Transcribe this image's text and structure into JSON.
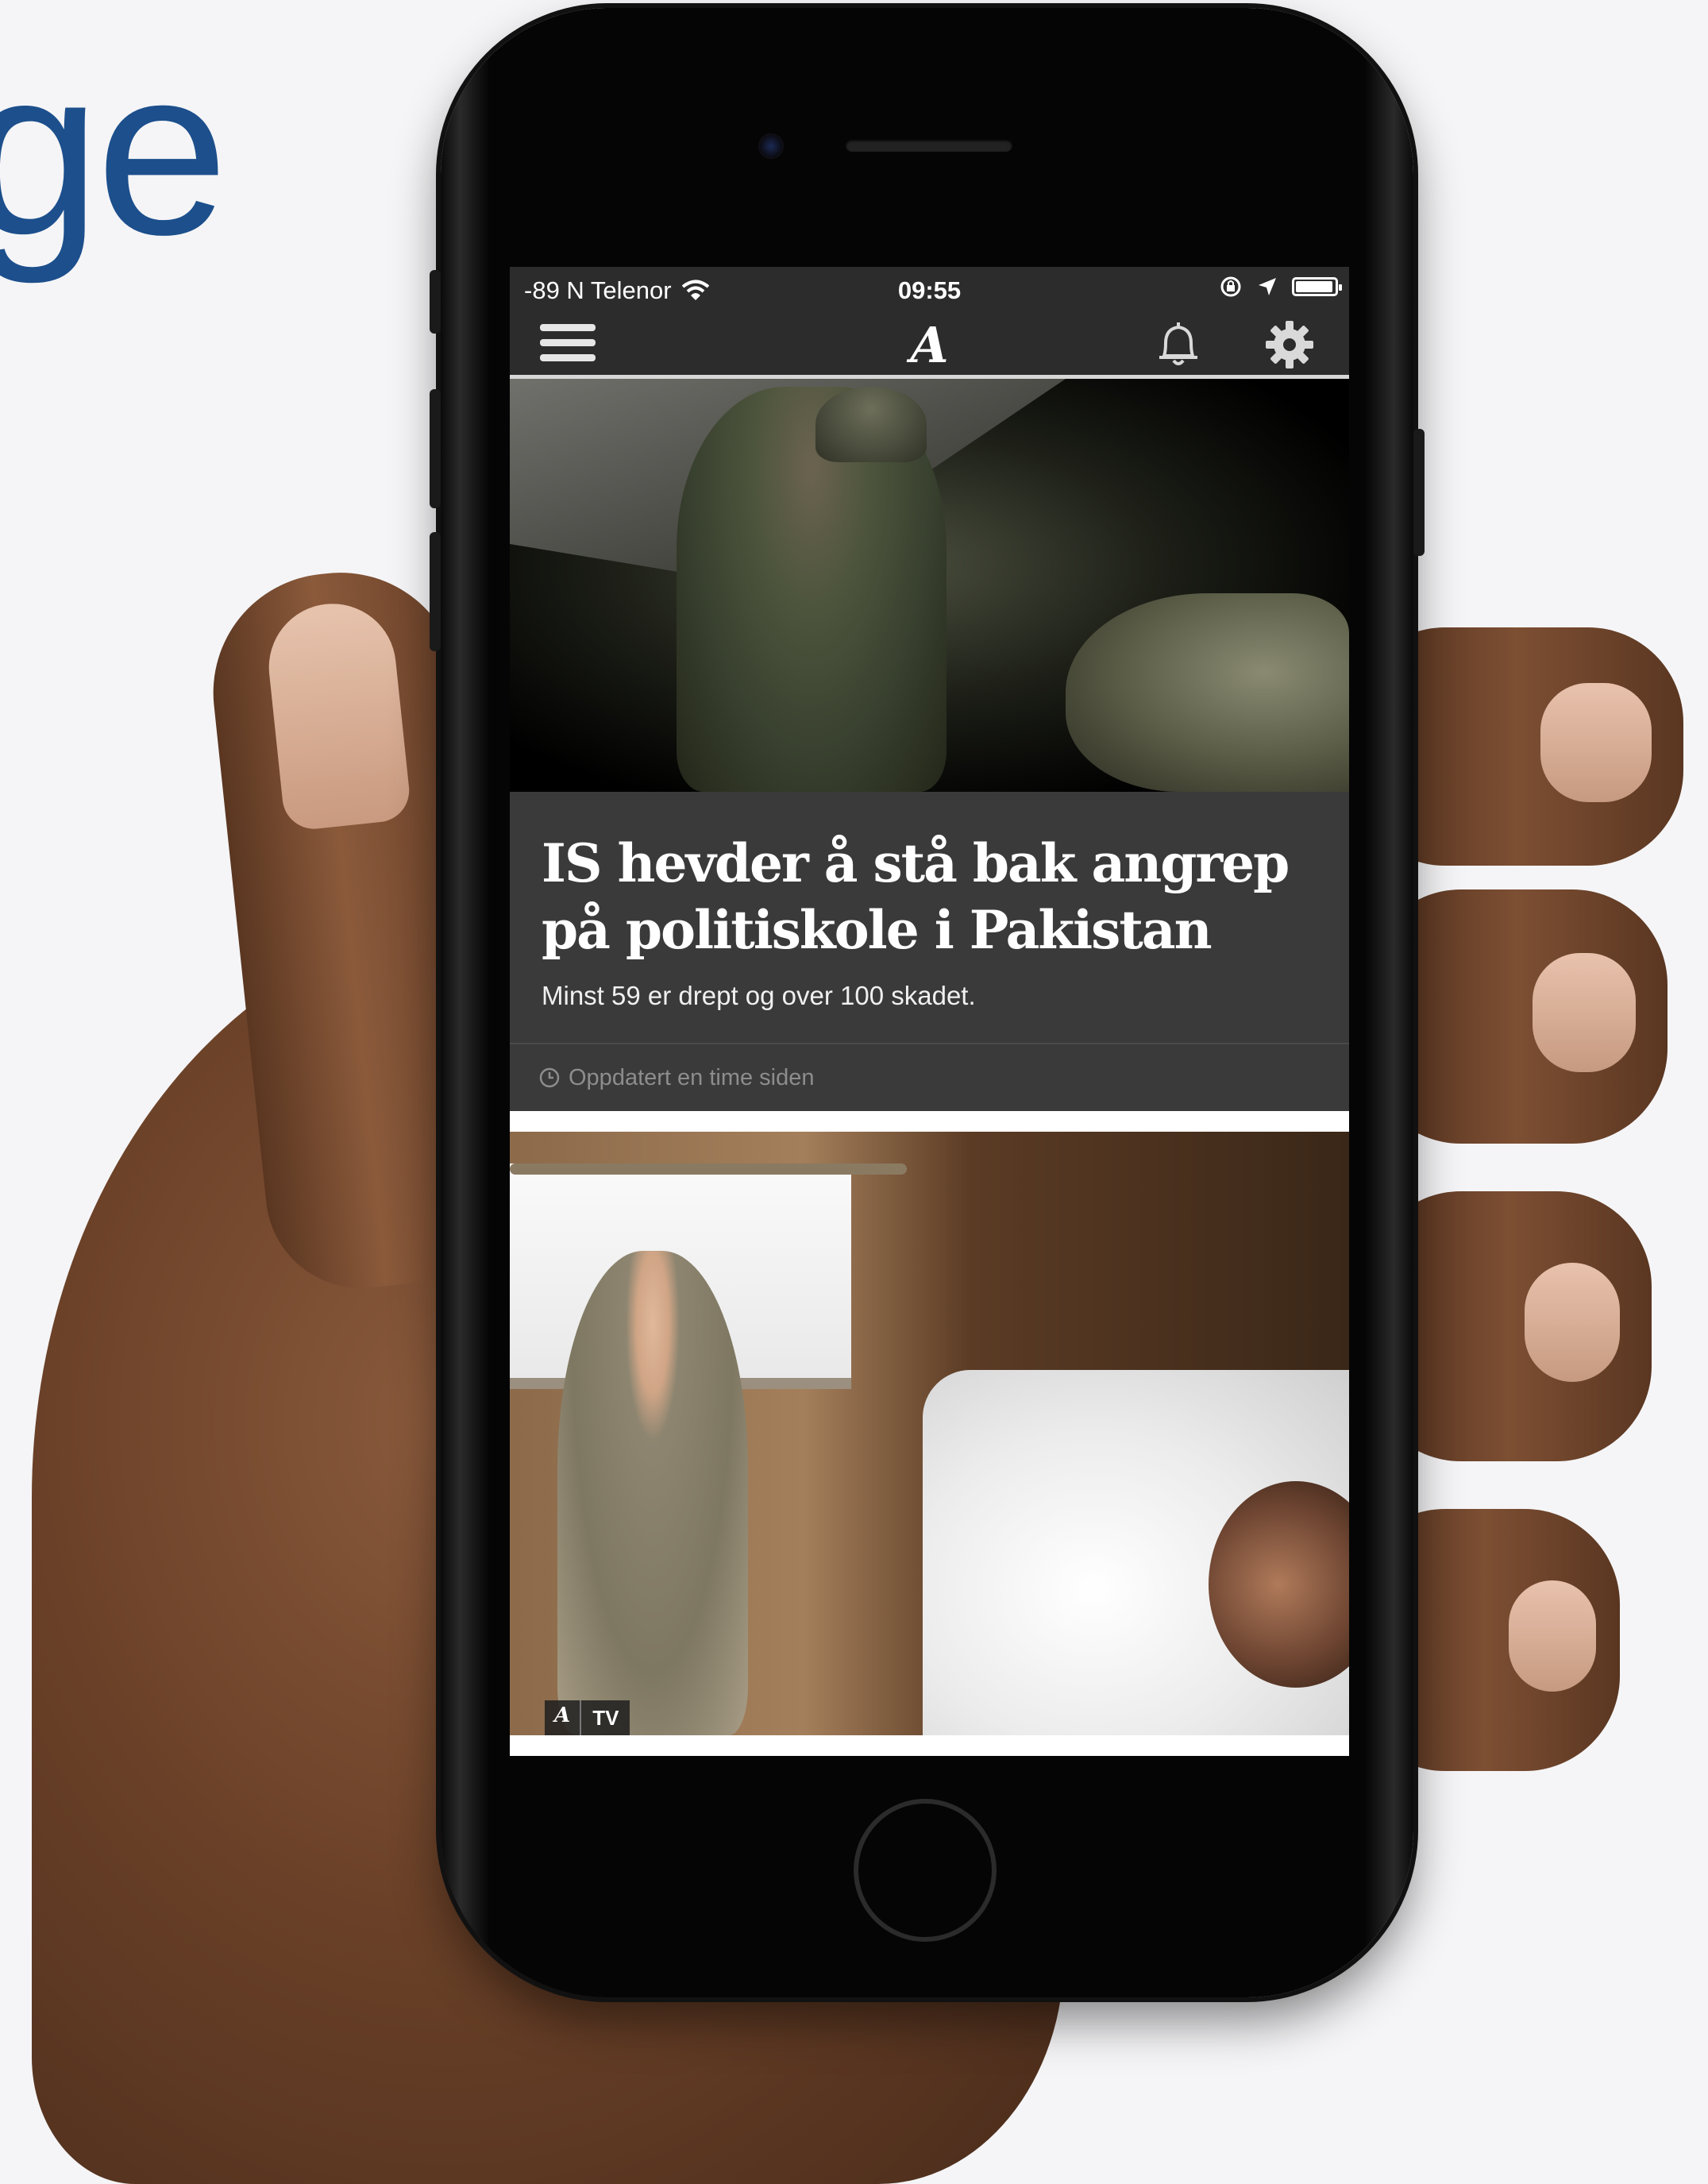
{
  "background_text": "ge",
  "status_bar": {
    "carrier": "-89 N Telenor",
    "time": "09:55",
    "battery_level": 0.95
  },
  "nav": {
    "logo": "A",
    "icons": [
      "menu-icon",
      "bell-icon",
      "gear-icon"
    ]
  },
  "articles": [
    {
      "headline": "IS hevder å stå bak angrep på politiskole i Pakistan",
      "lead": "Minst 59 er drept og over 100 skadet.",
      "updated": "Oppdatert en time siden"
    },
    {
      "badge_logo": "A",
      "badge_label": "TV"
    }
  ],
  "colors": {
    "bar_bg": "#2c2c2c",
    "card_bg": "#3a3a3a",
    "brand_text": "#1c4f8c"
  }
}
